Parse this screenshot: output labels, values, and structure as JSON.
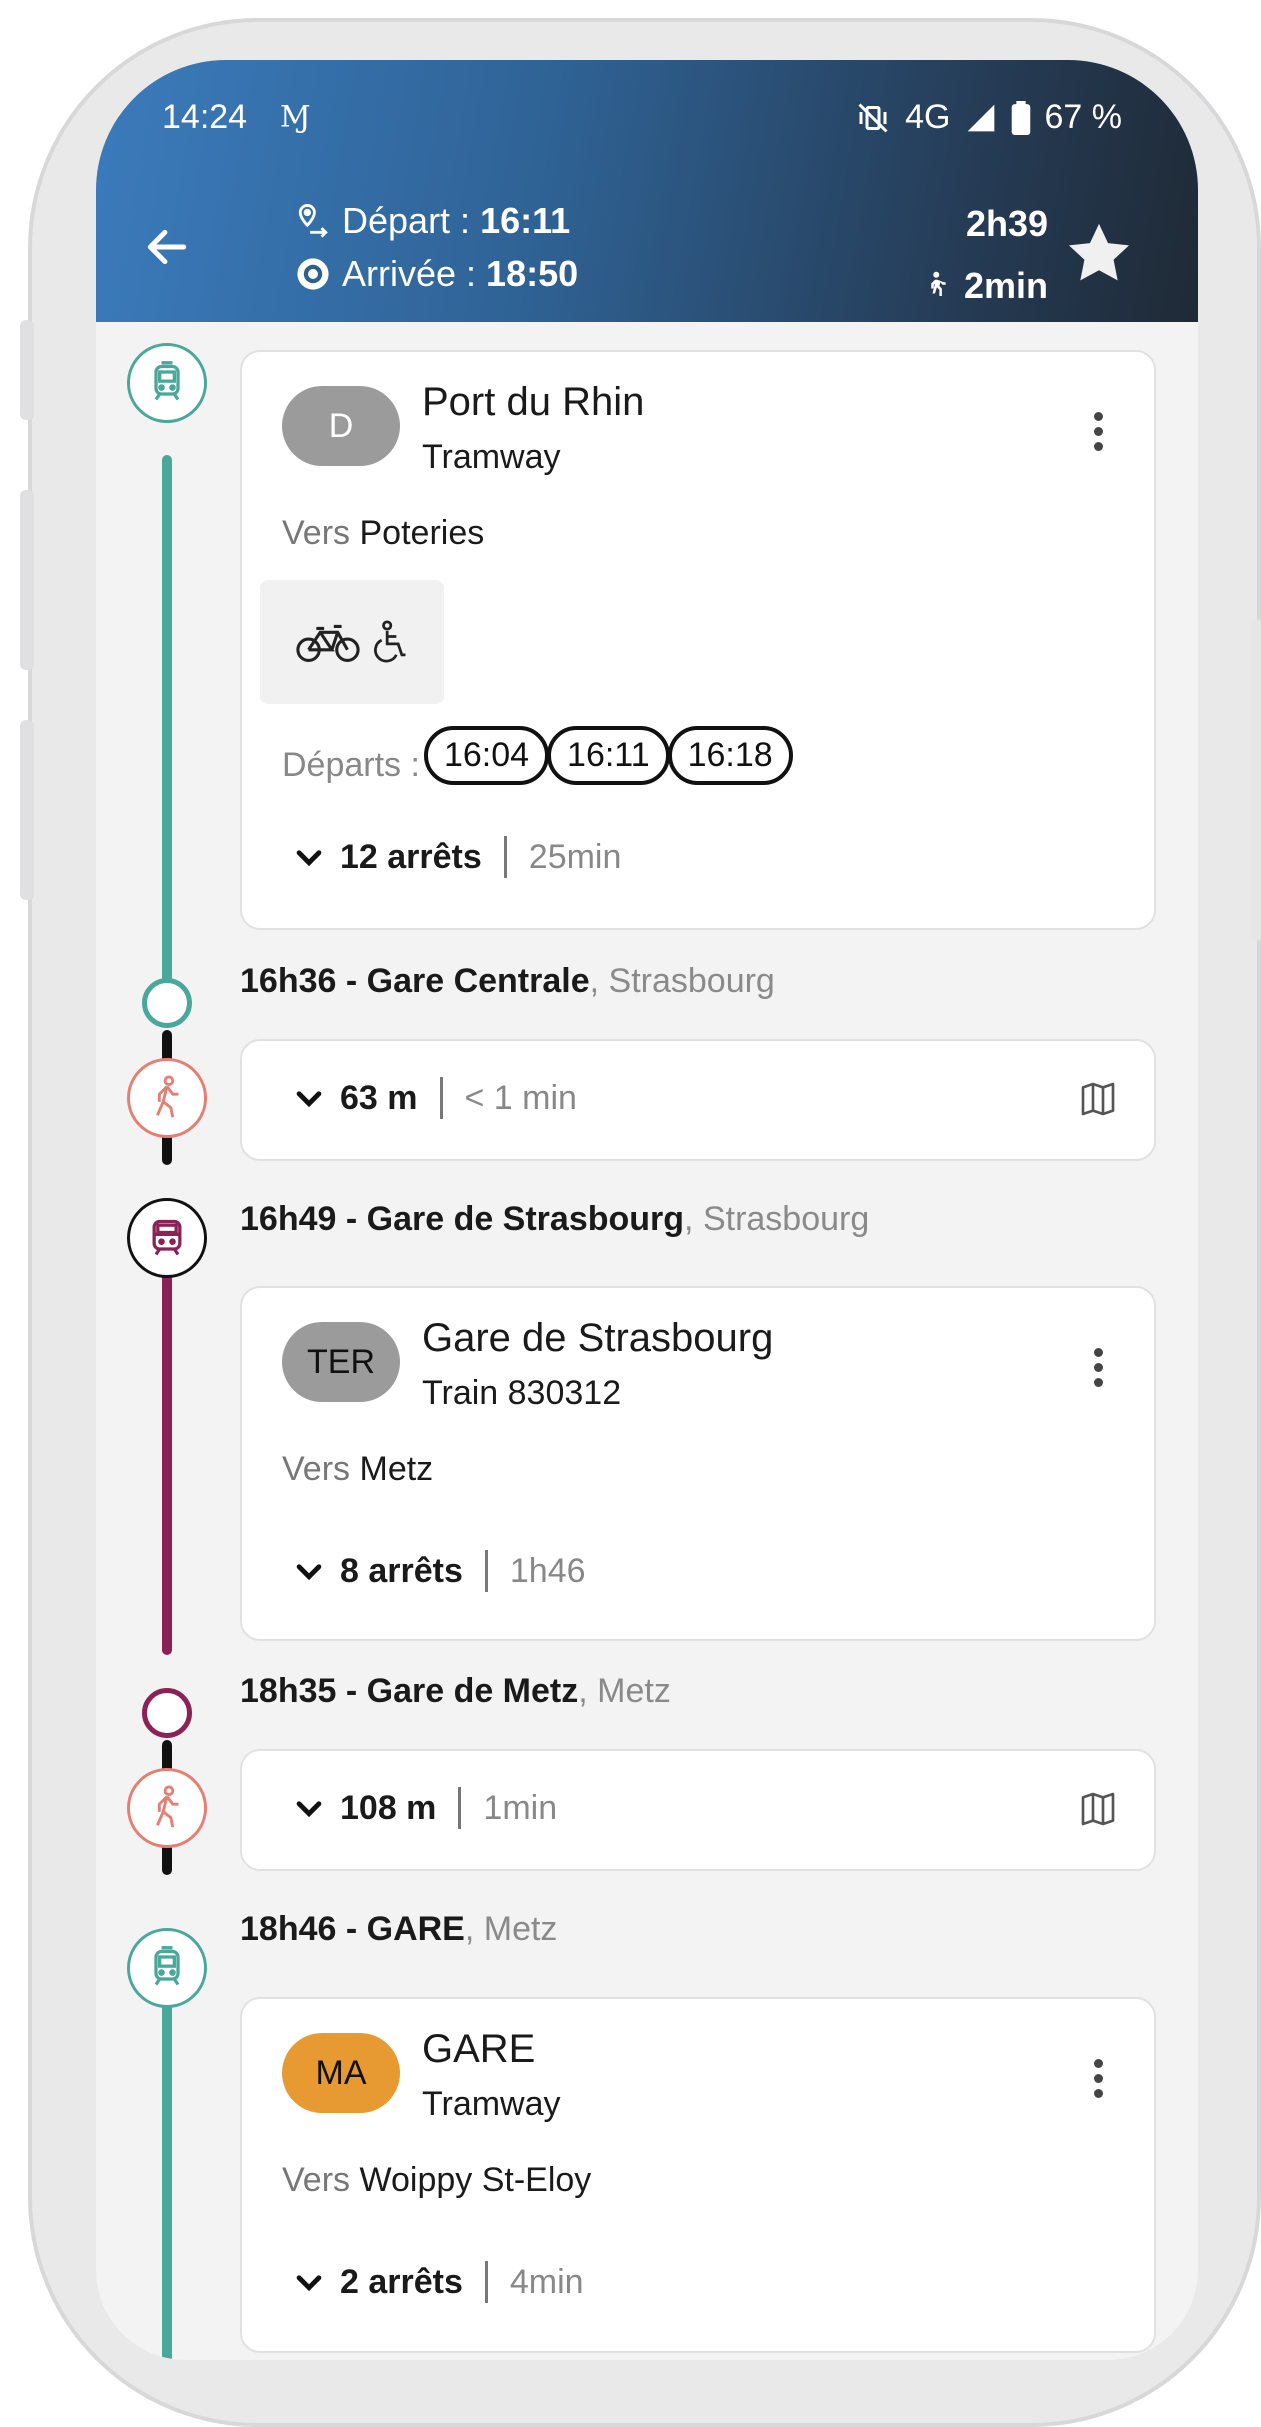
{
  "status_bar": {
    "time": "14:24",
    "carrier_icon": "Ɱ",
    "network": "4G",
    "battery": "67 %"
  },
  "header": {
    "depart_label": "Départ : ",
    "depart_time": "16:11",
    "arrival_label": "Arrivée : ",
    "arrival_time": "18:50",
    "duration": "2h39",
    "walk_total": "2min"
  },
  "legs": [
    {
      "mode": "tram",
      "line_code": "D",
      "line_name": "Port du Rhin",
      "line_type": "Tramway",
      "direction_prefix": "Vers",
      "direction": "Poteries",
      "features": [
        "bike-icon",
        "wheelchair-icon"
      ],
      "departures_label": "Départs :",
      "departures": [
        "16:04",
        "16:11",
        "16:18"
      ],
      "stops": "12 arrêts",
      "duration": "25min",
      "color": "#4aa89a"
    },
    {
      "mode": "walk",
      "distance": "63 m",
      "duration": "< 1 min"
    },
    {
      "mode": "train",
      "line_code": "TER",
      "line_name": "Gare de Strasbourg",
      "line_type": "Train 830312",
      "direction_prefix": "Vers",
      "direction": "Metz",
      "stops": "8 arrêts",
      "duration": "1h46",
      "color": "#8b2257"
    },
    {
      "mode": "walk",
      "distance": "108 m",
      "duration": "1min"
    },
    {
      "mode": "tram",
      "line_code": "MA",
      "line_name": "GARE",
      "line_type": "Tramway",
      "direction_prefix": "Vers",
      "direction": "Woippy St-Eloy",
      "stops": "2 arrêts",
      "duration": "4min",
      "color": "#4aa89a"
    }
  ],
  "stop_points": [
    {
      "time_name": "16h36 - Gare Centrale",
      "city": ", Strasbourg"
    },
    {
      "time_name": "16h49 - Gare de Strasbourg",
      "city": ", Strasbourg"
    },
    {
      "time_name": "18h35 - Gare de Metz",
      "city": ", Metz"
    },
    {
      "time_name": "18h46 - GARE",
      "city": ", Metz"
    }
  ],
  "colors": {
    "tram": "#4aa89a",
    "train": "#8b2257",
    "walk": "#e57f73",
    "badge_gray": "#9b9b9b",
    "badge_orange": "#e89a32"
  }
}
